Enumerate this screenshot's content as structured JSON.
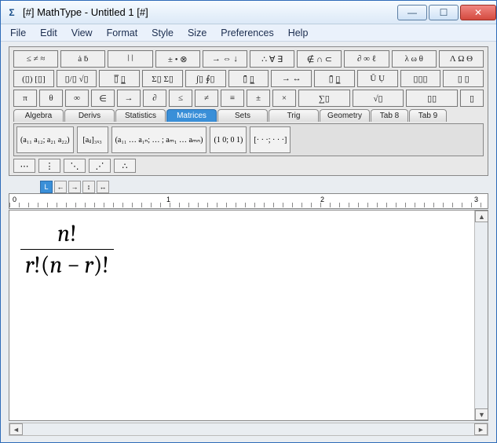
{
  "window": {
    "title": "[#] MathType - Untitled 1 [#]",
    "icon": "Σ"
  },
  "winbtns": {
    "min": "—",
    "max": "☐",
    "close": "✕"
  },
  "menu": [
    "File",
    "Edit",
    "View",
    "Format",
    "Style",
    "Size",
    "Preferences",
    "Help"
  ],
  "toolrows": [
    [
      "≤ ≠ ≈",
      "ȧ ḃ",
      "⦚ ⦚",
      "± • ⊗",
      "→ ⇔ ↓",
      "∴ ∀ ∃",
      "∉ ∩ ⊂",
      "∂ ∞ ℓ",
      "λ ω θ",
      "Λ Ω Θ"
    ],
    [
      "(▯) [▯]",
      "▯/▯ √▯",
      "▯̅  ▯̲",
      "Σ▯ Σ▯",
      "∫▯ ∮▯",
      "▯̄ ▯̲",
      "→ ↔",
      "▯̄ ▯̲",
      "Ū Ụ",
      "▯▯▯",
      "▯ ▯"
    ]
  ],
  "bigrow": [
    "π",
    "θ",
    "∞",
    "∈",
    "→",
    "∂",
    "≤",
    "≠",
    "≡",
    "±",
    "×",
    "∑▯",
    "√▯",
    "▯▯",
    "▯"
  ],
  "tabs": [
    "Algebra",
    "Derivs",
    "Statistics",
    "Matrices",
    "Sets",
    "Trig",
    "Geometry",
    "Tab 8",
    "Tab 9"
  ],
  "tabs_active": 3,
  "matrices": [
    "(a₁₁ a₁₂; a₂₁ a₂₂)",
    "[aᵢⱼ]₃ₓ₃",
    "(a₁₁ … a₁ₙ; … ; aₘ₁ … aₘₙ)",
    "(1 0; 0 1)",
    "[· · ·; · · ·]"
  ],
  "mat_small": [
    "⋯",
    "⋮",
    "⋱",
    "⋰",
    "∴"
  ],
  "smallbar": [
    "L",
    "←",
    "→",
    "↕",
    "↔"
  ],
  "ruler": {
    "marks": [
      "0",
      "1",
      "2",
      "3"
    ]
  },
  "formula": {
    "numerator_n": "n",
    "numerator_excl": "!",
    "den_r": "r",
    "den_nr": "n − r"
  },
  "scroll": {
    "left": "◄",
    "right": "►",
    "up": "▲",
    "down": "▼"
  }
}
